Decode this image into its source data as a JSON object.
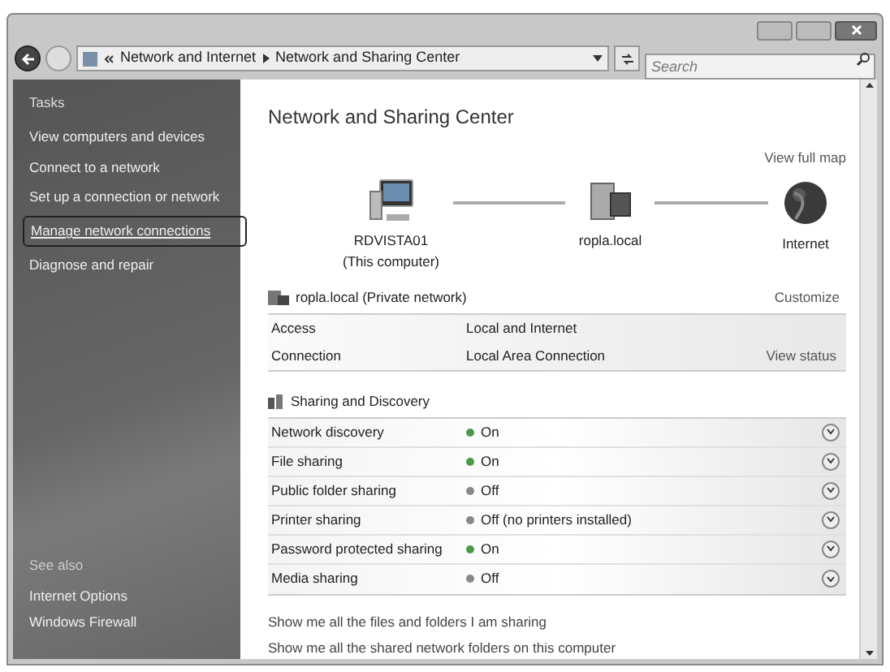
{
  "address_bar": {
    "crumbs": [
      {
        "label": "Network and Internet"
      },
      {
        "label": "Network and Sharing Center"
      }
    ],
    "search_placeholder": "Search"
  },
  "sidebar": {
    "heading": "Tasks",
    "items": [
      {
        "label": "View computers and devices",
        "highlighted": false
      },
      {
        "label": "Connect to a network",
        "highlighted": false
      },
      {
        "label": "Set up a connection or network",
        "highlighted": false
      },
      {
        "label": "Manage network connections",
        "highlighted": true
      },
      {
        "label": "Diagnose and repair",
        "highlighted": false
      }
    ],
    "see_also_heading": "See also",
    "see_also": [
      "Internet Options",
      "Windows Firewall"
    ]
  },
  "page_title": "Network and Sharing Center",
  "view_full_map": "View full map",
  "map": [
    {
      "kind": "computer",
      "label": "RDVISTA01",
      "sublabel": "(This computer)"
    },
    {
      "kind": "network",
      "label": "ropla.local"
    },
    {
      "kind": "internet",
      "label": "Internet"
    }
  ],
  "network": {
    "title": "ropla.local (Private network)",
    "customize": "Customize",
    "rows": [
      {
        "label": "Access",
        "value": "Local and Internet"
      },
      {
        "label": "Connection",
        "value": "Local Area Connection",
        "action": "View status"
      }
    ]
  },
  "sharing": {
    "title": "Sharing and Discovery",
    "rows": [
      {
        "label": "Network discovery",
        "value": "On",
        "on": true
      },
      {
        "label": "File sharing",
        "value": "On",
        "on": true
      },
      {
        "label": "Public folder sharing",
        "value": "Off",
        "on": false
      },
      {
        "label": "Printer sharing",
        "value": "Off (no printers installed)",
        "on": false
      },
      {
        "label": "Password protected sharing",
        "value": "On",
        "on": true
      },
      {
        "label": "Media sharing",
        "value": "Off",
        "on": false
      }
    ]
  },
  "links": [
    "Show me all the files and folders I am sharing",
    "Show me all the shared network folders on this computer"
  ]
}
